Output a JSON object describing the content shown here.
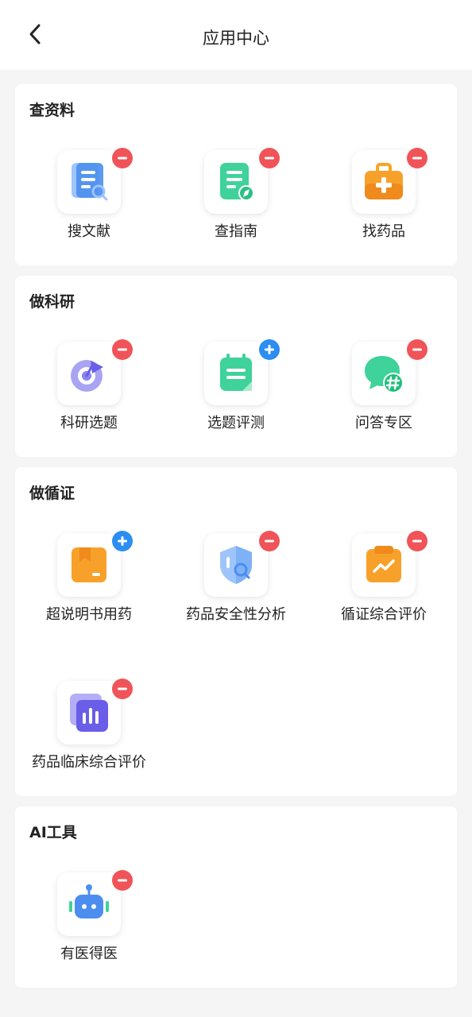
{
  "header": {
    "title": "应用中心",
    "back_icon": "chevron-left-icon"
  },
  "sections": [
    {
      "title": "查资料",
      "apps": [
        {
          "label": "搜文献",
          "icon": "document-search-icon",
          "badge": "remove"
        },
        {
          "label": "查指南",
          "icon": "guide-compass-icon",
          "badge": "remove"
        },
        {
          "label": "找药品",
          "icon": "medicine-kit-icon",
          "badge": "remove"
        }
      ]
    },
    {
      "title": "做科研",
      "apps": [
        {
          "label": "科研选题",
          "icon": "target-flag-icon",
          "badge": "remove"
        },
        {
          "label": "选题评测",
          "icon": "notepad-icon",
          "badge": "add"
        },
        {
          "label": "问答专区",
          "icon": "chat-hashtag-icon",
          "badge": "remove"
        }
      ]
    },
    {
      "title": "做循证",
      "apps": [
        {
          "label": "超说明书用药",
          "icon": "bookmark-box-icon",
          "badge": "add"
        },
        {
          "label": "药品安全性分析",
          "icon": "shield-search-icon",
          "badge": "remove"
        },
        {
          "label": "循证综合评价",
          "icon": "clipboard-trend-icon",
          "badge": "remove"
        },
        {
          "label": "药品临床综合评价",
          "icon": "bar-chart-icon",
          "badge": "remove"
        }
      ]
    },
    {
      "title": "AI工具",
      "apps": [
        {
          "label": "有医得医",
          "icon": "robot-icon",
          "badge": "remove"
        }
      ]
    }
  ],
  "colors": {
    "remove_badge": "#f05458",
    "add_badge": "#2b8ef0",
    "background": "#f5f5f5"
  }
}
